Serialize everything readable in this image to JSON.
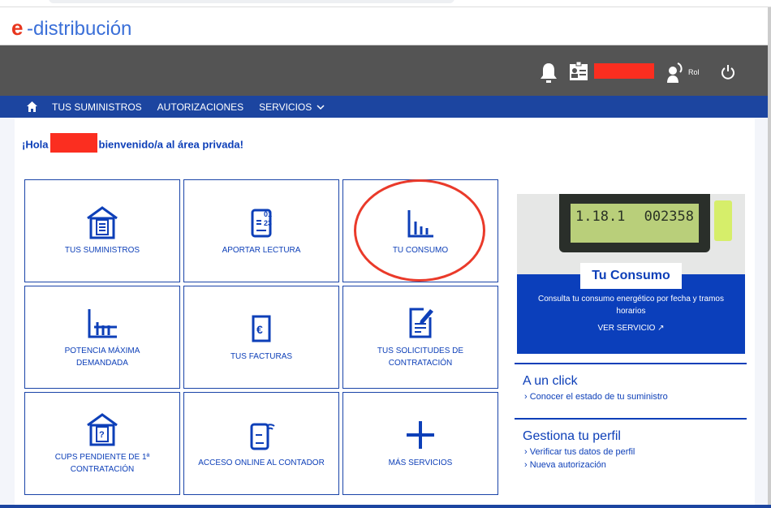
{
  "header": {
    "logo_e": "e",
    "logo_rest": "-distribución",
    "user_name_redacted": true,
    "rol_label": "Rol"
  },
  "nav": {
    "items": [
      "TUS SUMINISTROS",
      "AUTORIZACIONES",
      "SERVICIOS"
    ]
  },
  "welcome": {
    "prefix": "¡Hola",
    "suffix": "bienvenido/a al área privada!"
  },
  "tiles": [
    {
      "label": "TUS SUMINISTROS",
      "icon": "house-document-icon"
    },
    {
      "label": "APORTAR LECTURA",
      "icon": "meter-reading-icon"
    },
    {
      "label": "TU CONSUMO",
      "icon": "bar-chart-icon",
      "highlighted": true
    },
    {
      "label": "POTENCIA MÁXIMA DEMANDADA",
      "icon": "power-chart-icon"
    },
    {
      "label": "TUS FACTURAS",
      "icon": "euro-invoice-icon"
    },
    {
      "label": "TUS SOLICITUDES DE CONTRATACIÓN",
      "icon": "document-edit-icon"
    },
    {
      "label": "CUPS PENDIENTE DE 1ª CONTRATACIÓN",
      "icon": "house-question-icon"
    },
    {
      "label": "ACCESO ONLINE AL CONTADOR",
      "icon": "meter-wifi-icon"
    },
    {
      "label": "MÁS SERVICIOS",
      "icon": "plus-icon"
    }
  ],
  "promo": {
    "lcd_left": "1.18.1",
    "lcd_right": "002358",
    "title": "Tu Consumo",
    "text": "Consulta tu consumo energético por fecha y tramos horarios",
    "link": "VER SERVICIO"
  },
  "quick": {
    "title": "A un click",
    "links": [
      "Conocer el estado de tu suministro"
    ]
  },
  "profile": {
    "title": "Gestiona tu perfil",
    "links": [
      "Verificar tus datos de perfil",
      "Nueva autorización"
    ]
  },
  "colors": {
    "brand_blue": "#0d3fb8",
    "nav_blue": "#1c45a0",
    "header_grey": "#545454",
    "annotation_red": "#ea3a2a"
  }
}
